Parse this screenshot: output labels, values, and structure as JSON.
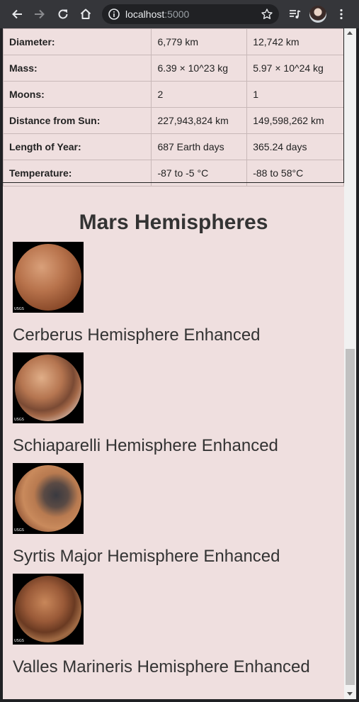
{
  "browser": {
    "host": "localhost",
    "port": ":5000"
  },
  "facts_table": {
    "rows": [
      {
        "label": "Diameter:",
        "mars": "6,779 km",
        "earth": "12,742 km"
      },
      {
        "label": "Mass:",
        "mars": "6.39 × 10^23 kg",
        "earth": "5.97 × 10^24 kg"
      },
      {
        "label": "Moons:",
        "mars": "2",
        "earth": "1"
      },
      {
        "label": "Distance from Sun:",
        "mars": "227,943,824 km",
        "earth": "149,598,262 km"
      },
      {
        "label": "Length of Year:",
        "mars": "687 Earth days",
        "earth": "365.24 days"
      },
      {
        "label": "Temperature:",
        "mars": "-87 to -5 °C",
        "earth": "-88 to 58°C"
      }
    ]
  },
  "hemispheres": {
    "title": "Mars Hemispheres",
    "items": [
      {
        "name": "Cerberus Hemisphere Enhanced",
        "logo": "USGS"
      },
      {
        "name": "Schiaparelli Hemisphere Enhanced",
        "logo": "USGS"
      },
      {
        "name": "Syrtis Major Hemisphere Enhanced",
        "logo": "USGS"
      },
      {
        "name": "Valles Marineris Hemisphere Enhanced",
        "logo": "USGS"
      }
    ]
  },
  "colors": {
    "page_background": "#efdfdf",
    "toolbar": "#35363a",
    "omnibox": "#202124"
  },
  "icons": {
    "back": "back-arrow-icon",
    "forward": "forward-arrow-icon",
    "reload": "reload-icon",
    "home": "home-icon",
    "info": "info-icon",
    "bookmark": "star-icon",
    "media": "media-queue-icon",
    "menu": "kebab-menu-icon"
  }
}
